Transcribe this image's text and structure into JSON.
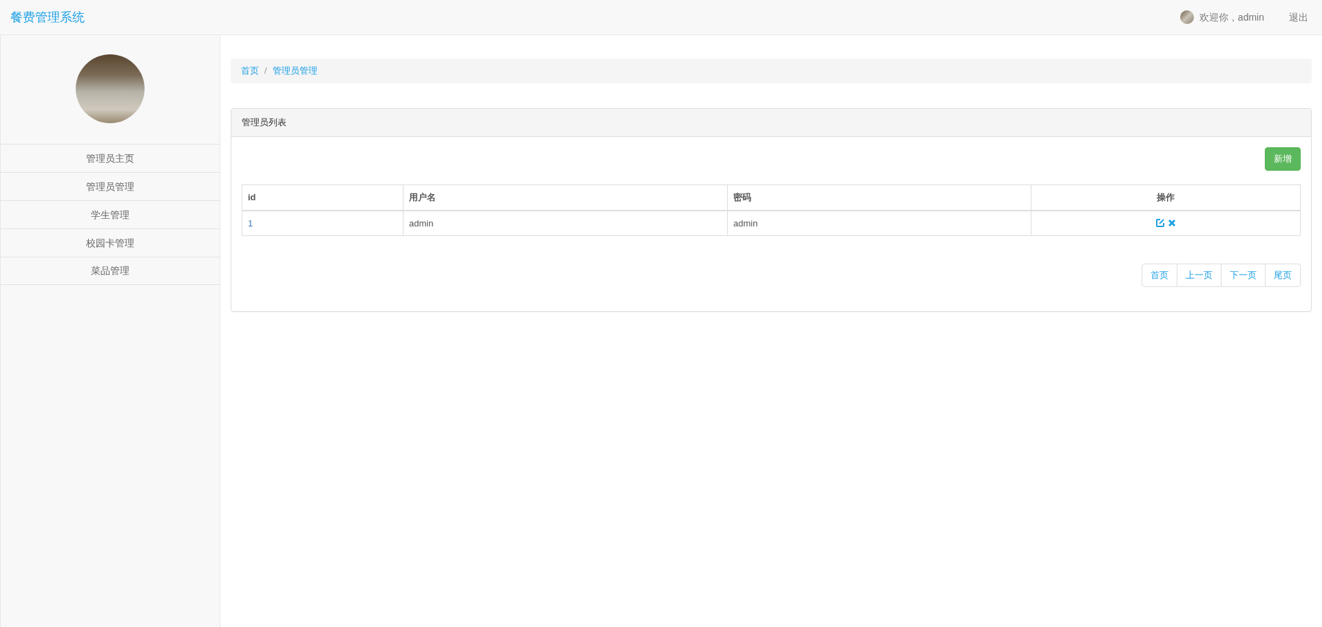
{
  "navbar": {
    "brand": "餐费管理系统",
    "welcome": "欢迎你，admin",
    "logout": "退出"
  },
  "sidebar": {
    "items": [
      {
        "label": "管理员主页"
      },
      {
        "label": "管理员管理"
      },
      {
        "label": "学生管理"
      },
      {
        "label": "校园卡管理"
      },
      {
        "label": "菜品管理"
      }
    ]
  },
  "breadcrumb": {
    "separator": "/",
    "items": [
      "首页",
      "管理员管理"
    ]
  },
  "panel": {
    "title": "管理员列表",
    "add_button": "新增",
    "table": {
      "columns": [
        "id",
        "用户名",
        "密码",
        "操作"
      ],
      "rows": [
        {
          "id": "1",
          "username": "admin",
          "password": "admin"
        }
      ]
    },
    "pagination": [
      "首页",
      "上一页",
      "下一页",
      "尾页"
    ]
  }
}
